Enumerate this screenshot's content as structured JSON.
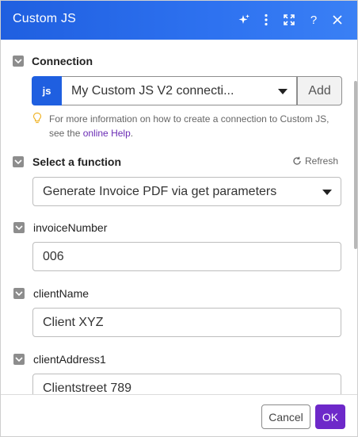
{
  "dialog": {
    "title": "Custom JS",
    "header_icons": [
      "sparkle-icon",
      "more-vertical-icon",
      "expand-icon",
      "help-icon",
      "close-icon"
    ]
  },
  "connection": {
    "label": "Connection",
    "badge": "js",
    "selected": "My Custom JS V2 connecti...",
    "add_label": "Add",
    "hint_text": "For more information on how to create a connection to Custom JS, see the ",
    "hint_link": "online Help",
    "hint_end": "."
  },
  "function": {
    "label": "Select a function",
    "refresh_label": "Refresh",
    "selected": "Generate Invoice PDF via get parameters"
  },
  "fields": [
    {
      "label": "invoiceNumber",
      "value": "006"
    },
    {
      "label": "clientName",
      "value": "Client XYZ"
    },
    {
      "label": "clientAddress1",
      "value": "Clientstreet 789"
    }
  ],
  "footer": {
    "cancel_label": "Cancel",
    "ok_label": "OK"
  },
  "colors": {
    "header": "#2e72f0",
    "badge": "#1f5fe0",
    "ok_button": "#6d28c9",
    "link": "#6a2bb5"
  }
}
